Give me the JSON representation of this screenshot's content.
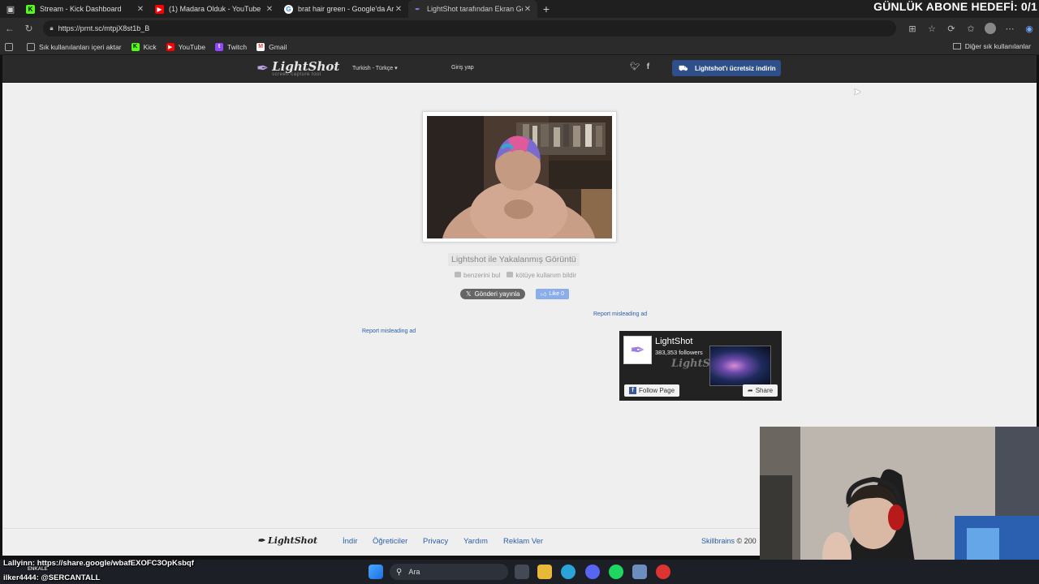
{
  "browser": {
    "tabs": [
      {
        "label": "Stream - Kick Dashboard",
        "icon": "kick-icon",
        "color": "#53fc18"
      },
      {
        "label": "(1) Madara Olduk - YouTube",
        "icon": "youtube-icon",
        "color": "#ff0000"
      },
      {
        "label": "brat hair green - Google'da Ara",
        "icon": "google-icon",
        "color": "#4285f4"
      },
      {
        "label": "LightShot tarafından Ekran Görün",
        "icon": "lightshot-icon",
        "color": "#9c7de0"
      }
    ],
    "url": "https://prnt.sc/mtpjX8st1b_B",
    "bookmarks": {
      "import": "Sık kullanılanları içeri aktar",
      "items": [
        {
          "label": "Kick",
          "icon": "kick-icon",
          "color": "#53fc18"
        },
        {
          "label": "YouTube",
          "icon": "youtube-icon",
          "color": "#ff0000"
        },
        {
          "label": "Twitch",
          "icon": "twitch-icon",
          "color": "#9146ff"
        },
        {
          "label": "Gmail",
          "icon": "gmail-icon",
          "color": "#ea4335"
        }
      ],
      "other": "Diğer sık kullanılanlar"
    }
  },
  "overlay": {
    "goal": "GÜNLÜK ABONE HEDEFİ: 0/1",
    "chat": [
      {
        "user": "Lallyinn",
        "message": ": https://share.google/wbafEXOFC3OpKsbqf"
      },
      {
        "user": "ilker4444",
        "message": ": @SERCANTALL"
      }
    ],
    "chat_small": "ENKALE"
  },
  "site": {
    "logo": "LightShot",
    "logo_sub": "screen capture tool",
    "language": "Turkish - Türkçe",
    "login": "Giriş yap",
    "download": "Lightshot'ı ücretsiz indirin",
    "caption": "Lightshot ile Yakalanmış Görüntü",
    "find_similar": "benzerini bul",
    "report_abuse": "kötüye kullanım bildir",
    "tweet": "Gönderi yayınla",
    "like": "Like 0",
    "report_ad": "Report misleading ad",
    "fb": {
      "name": "LightShot",
      "followers": "383,353 followers",
      "follow": "Follow Page",
      "share": "Share"
    },
    "footer": {
      "logo": "LightShot",
      "links": [
        "İndir",
        "Öğreticiler",
        "Privacy",
        "Yardım",
        "Reklam Ver"
      ],
      "company": "Skillbrains",
      "copyright": "© 200"
    }
  },
  "taskbar": {
    "search": "Ara"
  }
}
